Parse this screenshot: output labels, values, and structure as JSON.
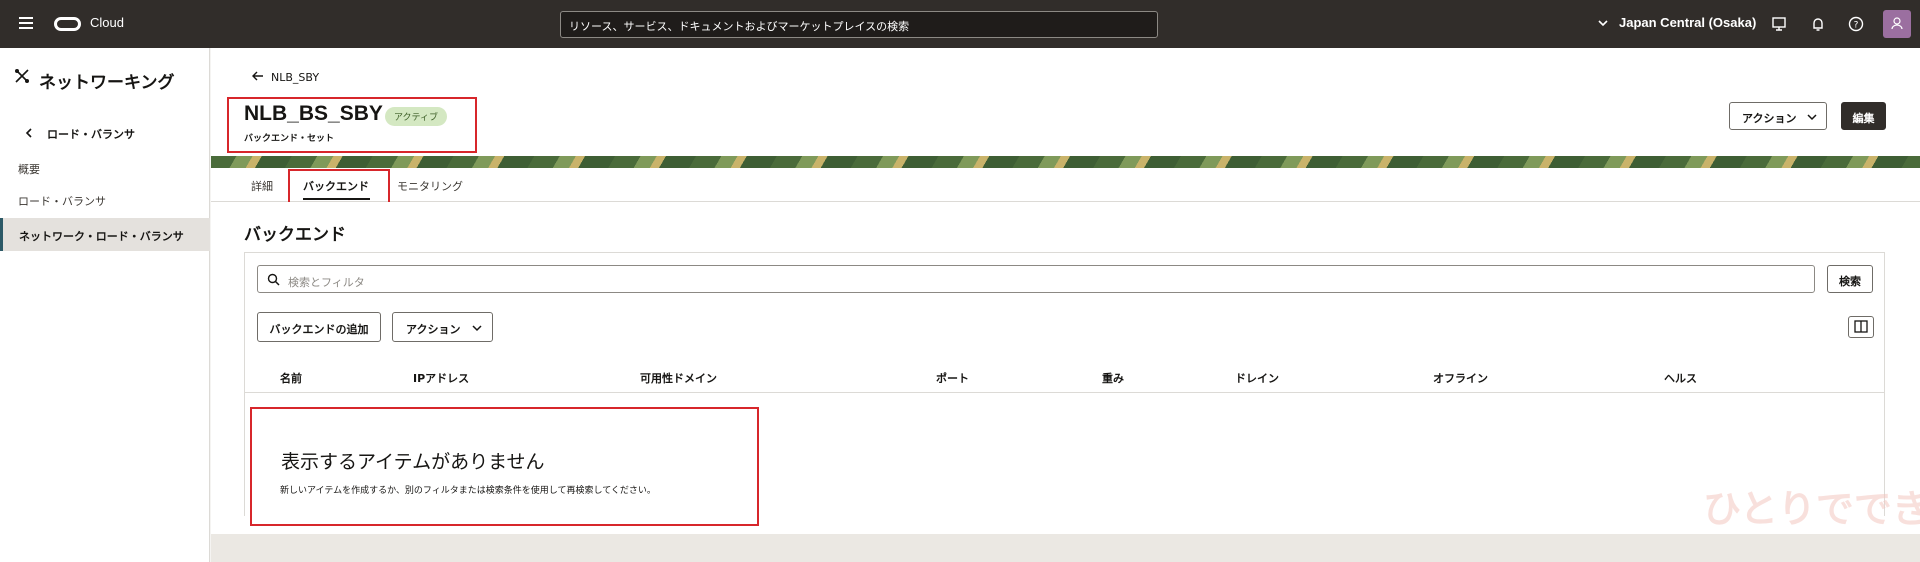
{
  "topbar": {
    "brand": "Cloud",
    "search_text": "リソース、サービス、ドキュメントおよびマーケットプレイスの検索",
    "region": "Japan Central (Osaka)"
  },
  "sidebar": {
    "title": "ネットワーキング",
    "back_label": "ロード・バランサ",
    "items": [
      {
        "label": "概要"
      },
      {
        "label": "ロード・バランサ"
      },
      {
        "label": "ネットワーク・ロード・バランサ"
      }
    ]
  },
  "header": {
    "breadcrumb": "NLB_SBY",
    "title": "NLB_BS_SBY",
    "status": "アクティブ",
    "subtitle": "バックエンド・セット",
    "actions_label": "アクション",
    "edit_label": "編集"
  },
  "tabs": [
    {
      "label": "詳細"
    },
    {
      "label": "バックエンド"
    },
    {
      "label": "モニタリング"
    }
  ],
  "section": {
    "title": "バックエンド",
    "filter_placeholder": "検索とフィルタ",
    "search_button": "検索",
    "add_button": "バックエンドの追加",
    "actions_button": "アクション"
  },
  "table": {
    "columns": [
      "名前",
      "IPアドレス",
      "可用性ドメイン",
      "ポート",
      "重み",
      "ドレイン",
      "オフライン",
      "ヘルス"
    ],
    "empty_title": "表示するアイテムがありません",
    "empty_description": "新しいアイテムを作成するか、別のフィルタまたは検索条件を使用して再検索してください。"
  },
  "watermark": "ひとりでできるもん",
  "colors": {
    "topbar": "#312d2a",
    "highlight": "#d7262b",
    "status_badge": "#d4e8c2"
  }
}
